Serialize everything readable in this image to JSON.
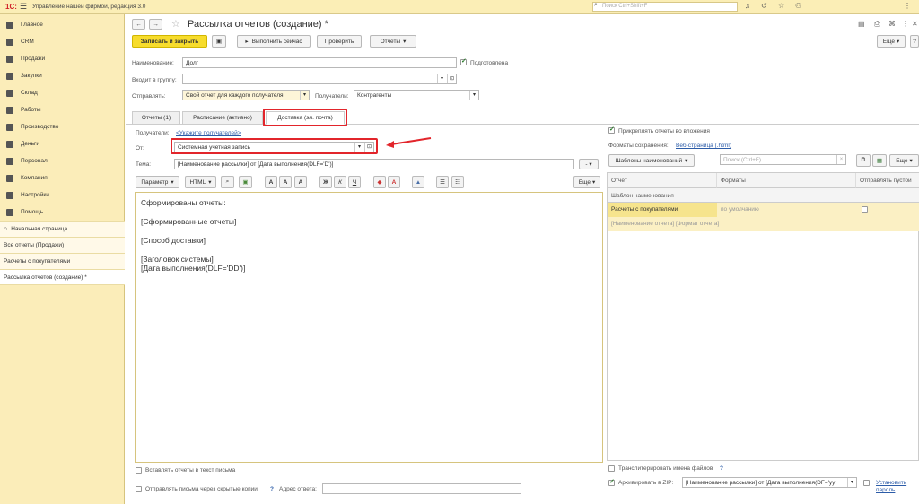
{
  "topbar": {
    "logo": "1С:",
    "app_title": "Управление нашей фирмой, редакция 3.0",
    "search_placeholder": "Поиск Ctrl+Shift+F"
  },
  "sidebar": {
    "items": [
      {
        "label": "Главное",
        "icon": "home-icon"
      },
      {
        "label": "CRM",
        "icon": "crm-icon"
      },
      {
        "label": "Продажи",
        "icon": "sales-icon"
      },
      {
        "label": "Закупки",
        "icon": "purchases-icon"
      },
      {
        "label": "Склад",
        "icon": "warehouse-icon"
      },
      {
        "label": "Работы",
        "icon": "works-icon"
      },
      {
        "label": "Производство",
        "icon": "production-icon"
      },
      {
        "label": "Деньги",
        "icon": "money-icon"
      },
      {
        "label": "Персонал",
        "icon": "staff-icon"
      },
      {
        "label": "Компания",
        "icon": "company-icon"
      },
      {
        "label": "Настройки",
        "icon": "settings-icon"
      },
      {
        "label": "Помощь",
        "icon": "help-icon"
      }
    ],
    "open_windows": [
      "Начальная страница",
      "Все отчеты (Продажи)",
      "Расчеты с покупателями",
      "Рассылка отчетов (создание) *"
    ]
  },
  "form": {
    "title": "Рассылка отчетов (создание) *",
    "toolbar": {
      "save_close": "Записать и закрыть",
      "run_now": "Выполнить сейчас",
      "check": "Проверить",
      "reports": "Отчеты",
      "more": "Еще",
      "help": "?"
    },
    "name_label": "Наименование:",
    "name_value": "Долг",
    "prepared_label": "Подготовлена",
    "group_label": "Входит в группу:",
    "group_value": "",
    "send_label": "Отправлять:",
    "send_value": "Свой отчет для каждого получателя",
    "recipients_label": "Получатели:",
    "recipients_value": "Контрагенты",
    "tabs": [
      "Отчеты (1)",
      "Расписание (активно)",
      "Доставка (эл. почта)"
    ],
    "delivery": {
      "recipients_label": "Получатели:",
      "recipients_link": "<Укажите получателей>",
      "from_label": "От:",
      "from_value": "Системная учетная запись",
      "subject_label": "Тема:",
      "subject_value": "[Наименование рассылки] от [Дата выполнения(DLF='D')]",
      "editor_tools": [
        "Параметр",
        "HTML",
        "Еще"
      ],
      "body_lines": [
        "Сформированы отчеты:",
        "[Сформированные отчеты]",
        "[Способ доставки]",
        "[Заголовок системы]",
        "[Дата выполнения(DLF='DD')]"
      ],
      "insert_reports": "Вставлять отчеты в текст письма",
      "hidden_copies": "Отправлять письма через скрытые копии",
      "hidden_help": "?",
      "reply_label": "Адрес ответа:",
      "reply_value": ""
    },
    "right": {
      "attach_label": "Прикреплять отчеты во вложения",
      "formats_label": "Форматы сохранения:",
      "formats_link": "Веб-страница (.html)",
      "templates_btn": "Шаблоны наименований",
      "search_placeholder": "Поиск (Ctrl+F)",
      "more": "Еще",
      "headers": [
        "Отчет",
        "Форматы",
        "Отправлять пустой"
      ],
      "template_header": "Шаблон наименования",
      "rows": [
        {
          "report": "Расчеты с покупателями",
          "formats": "по умолчанию",
          "template": "[Наименование отчета] [Формат отчета]"
        }
      ],
      "transliterate": "Транслитерировать имена файлов",
      "translit_help": "?",
      "zip_label": "Архивировать в ZIP:",
      "zip_value": "[Наименование рассылки] от [Дата выполнения(DF='уу",
      "set_password": "Установить пароль"
    }
  }
}
